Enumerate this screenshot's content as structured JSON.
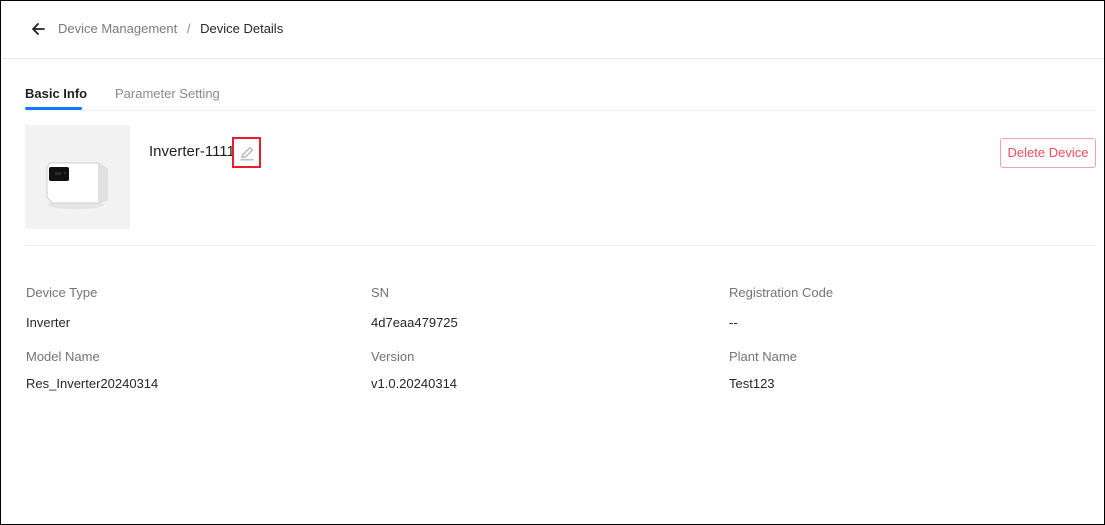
{
  "breadcrumb": {
    "parent": "Device Management",
    "separator": "/",
    "current": "Device Details"
  },
  "tabs": [
    {
      "label": "Basic Info",
      "active": true
    },
    {
      "label": "Parameter Setting",
      "active": false
    }
  ],
  "device": {
    "name": "Inverter-1111",
    "delete_label": "Delete Device"
  },
  "fields": {
    "device_type": {
      "label": "Device Type",
      "value": "Inverter"
    },
    "sn": {
      "label": "SN",
      "value": "4d7eaa479725"
    },
    "registration_code": {
      "label": "Registration Code",
      "value": "--"
    },
    "model_name": {
      "label": "Model Name",
      "value": "Res_Inverter20240314"
    },
    "version": {
      "label": "Version",
      "value": "v1.0.20240314"
    },
    "plant_name": {
      "label": "Plant Name",
      "value": "Test123"
    }
  },
  "icons": {
    "back": "arrow-left-icon",
    "edit": "pencil-icon"
  },
  "colors": {
    "accent": "#1677ff",
    "danger": "#ee4d5a",
    "highlight": "#e41f2b"
  }
}
